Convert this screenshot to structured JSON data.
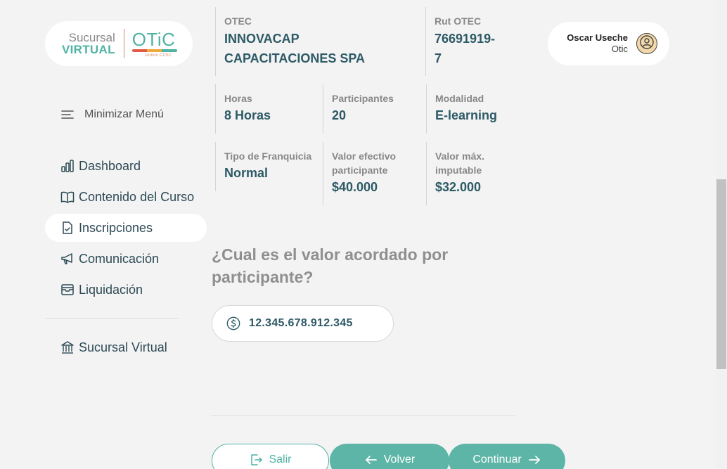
{
  "logo": {
    "sucursal": "Sucursal",
    "virtual": "VIRTUAL",
    "otic": "OTiC",
    "sub": "somos CChC"
  },
  "sidebar": {
    "minimize_label": "Minimizar Menú",
    "items": [
      {
        "label": "Dashboard",
        "icon": "bar-chart-icon"
      },
      {
        "label": "Contenido del Curso",
        "icon": "book-icon"
      },
      {
        "label": "Inscripciones",
        "icon": "document-check-icon"
      },
      {
        "label": "Comunicación",
        "icon": "megaphone-icon"
      },
      {
        "label": "Liquidación",
        "icon": "archive-icon"
      }
    ],
    "footer_item": {
      "label": "Sucursal Virtual",
      "icon": "bank-icon"
    }
  },
  "info": {
    "otec_label": "OTEC",
    "otec_value": "INNOVACAP CAPACITACIONES SPA",
    "rut_label": "Rut OTEC",
    "rut_value": "76691919-7",
    "horas_label": "Horas",
    "horas_value": "8 Horas",
    "participantes_label": "Participantes",
    "participantes_value": "20",
    "modalidad_label": "Modalidad",
    "modalidad_value": "E-learning",
    "franquicia_label": "Tipo de Franquicia",
    "franquicia_value": "Normal",
    "valor_efectivo_label": "Valor efectivo participante",
    "valor_efectivo_value": "$40.000",
    "valor_max_label": "Valor máx. imputable",
    "valor_max_value": "$32.000"
  },
  "question": "¿Cual es el valor acordado por participante?",
  "amount_value": "12.345.678.912.345",
  "buttons": {
    "salir": "Salir",
    "volver": "Volver",
    "continuar": "Continuar"
  },
  "user": {
    "name": "Oscar Useche",
    "role": "Otic"
  },
  "colors": {
    "accent": "#5cb5a6",
    "text_dark": "#2d5a66",
    "background": "#f3f3f3"
  }
}
